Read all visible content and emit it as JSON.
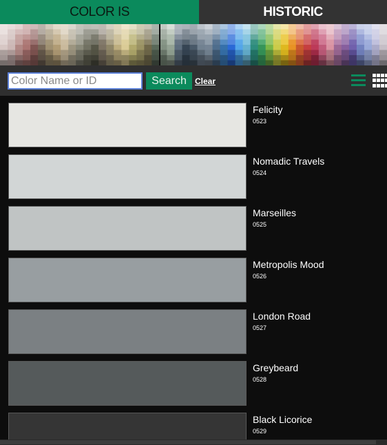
{
  "tabs": [
    {
      "label": "COLOR IS",
      "active": true
    },
    {
      "label": "HISTORIC",
      "active": false
    }
  ],
  "palette_strip": {
    "icon": "color-palette-strip",
    "column_colors": [
      "#d9c9c6",
      "#c9b3b1",
      "#b88e8b",
      "#a9726f",
      "#8a5b58",
      "#7a6a5a",
      "#9a8a6a",
      "#b8a27a",
      "#c8b89a",
      "#a8a08a",
      "#8a8a7a",
      "#6a6a5a",
      "#5a5a4a",
      "#7a7060",
      "#9a9070",
      "#c0b080",
      "#d8c890",
      "#b8b070",
      "#989060",
      "#787050",
      "#5a6a5a",
      "#7a8a7a",
      "#9aaa9a",
      "#5a6a7a",
      "#3a4a5a",
      "#4a5a6a",
      "#6a7a8a",
      "#7a8a9a",
      "#4a6a8a",
      "#3a7ab8",
      "#2a6ad8",
      "#4aa0e8",
      "#6ab8d8",
      "#2a8a7a",
      "#3aa060",
      "#7ab848",
      "#c8c840",
      "#e8c020",
      "#e89020",
      "#d86030",
      "#c84040",
      "#b83050",
      "#c86080",
      "#d890a0",
      "#a870a0",
      "#8860a0",
      "#6858a8",
      "#7888c8",
      "#98a8d8",
      "#b8b8d8",
      "#c8c0c8"
    ]
  },
  "search": {
    "placeholder": "Color Name or ID",
    "value": "",
    "button_label": "Search",
    "clear_label": "Clear"
  },
  "view_toggle": {
    "list_icon": "list-view-icon",
    "grid_icon": "grid-view-icon",
    "accent_color": "#0b8a5c"
  },
  "colors": [
    {
      "name": "Felicity",
      "id": "0523",
      "hex": "#e6e6e2"
    },
    {
      "name": "Nomadic Travels",
      "id": "0524",
      "hex": "#d2d6d6"
    },
    {
      "name": "Marseilles",
      "id": "0525",
      "hex": "#c0c4c4"
    },
    {
      "name": "Metropolis Mood",
      "id": "0526",
      "hex": "#989ea1"
    },
    {
      "name": "London Road",
      "id": "0527",
      "hex": "#7b8083"
    },
    {
      "name": "Greybeard",
      "id": "0528",
      "hex": "#555a5b"
    },
    {
      "name": "Black Licorice",
      "id": "0529",
      "hex": "#353535"
    }
  ]
}
